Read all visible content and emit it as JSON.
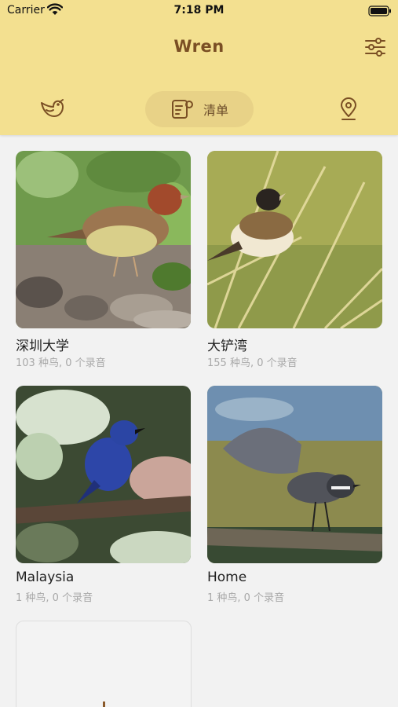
{
  "status_bar": {
    "carrier": "Carrier",
    "time": "7:18 PM"
  },
  "app": {
    "title": "Wren"
  },
  "tabs": {
    "list_label": "清单"
  },
  "lists": [
    {
      "name": "深圳大学",
      "summary": "103 种鸟, 0 个录音"
    },
    {
      "name": "大铲湾",
      "summary": "155 种鸟, 0 个录音"
    },
    {
      "name": "Malaysia",
      "summary": "1 种鸟, 0 个录音"
    },
    {
      "name": "Home",
      "summary": "1 种鸟, 0 个录音"
    }
  ],
  "colors": {
    "header": "#f3e090",
    "accent": "#7a4f24",
    "pill": "#e8d287"
  }
}
